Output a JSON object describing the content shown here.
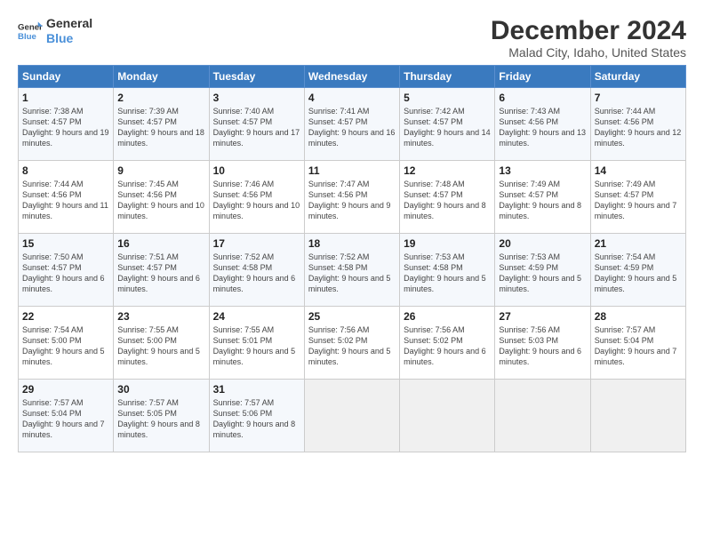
{
  "logo": {
    "general": "General",
    "blue": "Blue"
  },
  "title": "December 2024",
  "subtitle": "Malad City, Idaho, United States",
  "days_header": [
    "Sunday",
    "Monday",
    "Tuesday",
    "Wednesday",
    "Thursday",
    "Friday",
    "Saturday"
  ],
  "weeks": [
    [
      {
        "day": "1",
        "sunrise": "Sunrise: 7:38 AM",
        "sunset": "Sunset: 4:57 PM",
        "daylight": "Daylight: 9 hours and 19 minutes."
      },
      {
        "day": "2",
        "sunrise": "Sunrise: 7:39 AM",
        "sunset": "Sunset: 4:57 PM",
        "daylight": "Daylight: 9 hours and 18 minutes."
      },
      {
        "day": "3",
        "sunrise": "Sunrise: 7:40 AM",
        "sunset": "Sunset: 4:57 PM",
        "daylight": "Daylight: 9 hours and 17 minutes."
      },
      {
        "day": "4",
        "sunrise": "Sunrise: 7:41 AM",
        "sunset": "Sunset: 4:57 PM",
        "daylight": "Daylight: 9 hours and 16 minutes."
      },
      {
        "day": "5",
        "sunrise": "Sunrise: 7:42 AM",
        "sunset": "Sunset: 4:57 PM",
        "daylight": "Daylight: 9 hours and 14 minutes."
      },
      {
        "day": "6",
        "sunrise": "Sunrise: 7:43 AM",
        "sunset": "Sunset: 4:56 PM",
        "daylight": "Daylight: 9 hours and 13 minutes."
      },
      {
        "day": "7",
        "sunrise": "Sunrise: 7:44 AM",
        "sunset": "Sunset: 4:56 PM",
        "daylight": "Daylight: 9 hours and 12 minutes."
      }
    ],
    [
      {
        "day": "8",
        "sunrise": "Sunrise: 7:44 AM",
        "sunset": "Sunset: 4:56 PM",
        "daylight": "Daylight: 9 hours and 11 minutes."
      },
      {
        "day": "9",
        "sunrise": "Sunrise: 7:45 AM",
        "sunset": "Sunset: 4:56 PM",
        "daylight": "Daylight: 9 hours and 10 minutes."
      },
      {
        "day": "10",
        "sunrise": "Sunrise: 7:46 AM",
        "sunset": "Sunset: 4:56 PM",
        "daylight": "Daylight: 9 hours and 10 minutes."
      },
      {
        "day": "11",
        "sunrise": "Sunrise: 7:47 AM",
        "sunset": "Sunset: 4:56 PM",
        "daylight": "Daylight: 9 hours and 9 minutes."
      },
      {
        "day": "12",
        "sunrise": "Sunrise: 7:48 AM",
        "sunset": "Sunset: 4:57 PM",
        "daylight": "Daylight: 9 hours and 8 minutes."
      },
      {
        "day": "13",
        "sunrise": "Sunrise: 7:49 AM",
        "sunset": "Sunset: 4:57 PM",
        "daylight": "Daylight: 9 hours and 8 minutes."
      },
      {
        "day": "14",
        "sunrise": "Sunrise: 7:49 AM",
        "sunset": "Sunset: 4:57 PM",
        "daylight": "Daylight: 9 hours and 7 minutes."
      }
    ],
    [
      {
        "day": "15",
        "sunrise": "Sunrise: 7:50 AM",
        "sunset": "Sunset: 4:57 PM",
        "daylight": "Daylight: 9 hours and 6 minutes."
      },
      {
        "day": "16",
        "sunrise": "Sunrise: 7:51 AM",
        "sunset": "Sunset: 4:57 PM",
        "daylight": "Daylight: 9 hours and 6 minutes."
      },
      {
        "day": "17",
        "sunrise": "Sunrise: 7:52 AM",
        "sunset": "Sunset: 4:58 PM",
        "daylight": "Daylight: 9 hours and 6 minutes."
      },
      {
        "day": "18",
        "sunrise": "Sunrise: 7:52 AM",
        "sunset": "Sunset: 4:58 PM",
        "daylight": "Daylight: 9 hours and 5 minutes."
      },
      {
        "day": "19",
        "sunrise": "Sunrise: 7:53 AM",
        "sunset": "Sunset: 4:58 PM",
        "daylight": "Daylight: 9 hours and 5 minutes."
      },
      {
        "day": "20",
        "sunrise": "Sunrise: 7:53 AM",
        "sunset": "Sunset: 4:59 PM",
        "daylight": "Daylight: 9 hours and 5 minutes."
      },
      {
        "day": "21",
        "sunrise": "Sunrise: 7:54 AM",
        "sunset": "Sunset: 4:59 PM",
        "daylight": "Daylight: 9 hours and 5 minutes."
      }
    ],
    [
      {
        "day": "22",
        "sunrise": "Sunrise: 7:54 AM",
        "sunset": "Sunset: 5:00 PM",
        "daylight": "Daylight: 9 hours and 5 minutes."
      },
      {
        "day": "23",
        "sunrise": "Sunrise: 7:55 AM",
        "sunset": "Sunset: 5:00 PM",
        "daylight": "Daylight: 9 hours and 5 minutes."
      },
      {
        "day": "24",
        "sunrise": "Sunrise: 7:55 AM",
        "sunset": "Sunset: 5:01 PM",
        "daylight": "Daylight: 9 hours and 5 minutes."
      },
      {
        "day": "25",
        "sunrise": "Sunrise: 7:56 AM",
        "sunset": "Sunset: 5:02 PM",
        "daylight": "Daylight: 9 hours and 5 minutes."
      },
      {
        "day": "26",
        "sunrise": "Sunrise: 7:56 AM",
        "sunset": "Sunset: 5:02 PM",
        "daylight": "Daylight: 9 hours and 6 minutes."
      },
      {
        "day": "27",
        "sunrise": "Sunrise: 7:56 AM",
        "sunset": "Sunset: 5:03 PM",
        "daylight": "Daylight: 9 hours and 6 minutes."
      },
      {
        "day": "28",
        "sunrise": "Sunrise: 7:57 AM",
        "sunset": "Sunset: 5:04 PM",
        "daylight": "Daylight: 9 hours and 7 minutes."
      }
    ],
    [
      {
        "day": "29",
        "sunrise": "Sunrise: 7:57 AM",
        "sunset": "Sunset: 5:04 PM",
        "daylight": "Daylight: 9 hours and 7 minutes."
      },
      {
        "day": "30",
        "sunrise": "Sunrise: 7:57 AM",
        "sunset": "Sunset: 5:05 PM",
        "daylight": "Daylight: 9 hours and 8 minutes."
      },
      {
        "day": "31",
        "sunrise": "Sunrise: 7:57 AM",
        "sunset": "Sunset: 5:06 PM",
        "daylight": "Daylight: 9 hours and 8 minutes."
      },
      {
        "day": "",
        "sunrise": "",
        "sunset": "",
        "daylight": ""
      },
      {
        "day": "",
        "sunrise": "",
        "sunset": "",
        "daylight": ""
      },
      {
        "day": "",
        "sunrise": "",
        "sunset": "",
        "daylight": ""
      },
      {
        "day": "",
        "sunrise": "",
        "sunset": "",
        "daylight": ""
      }
    ]
  ]
}
